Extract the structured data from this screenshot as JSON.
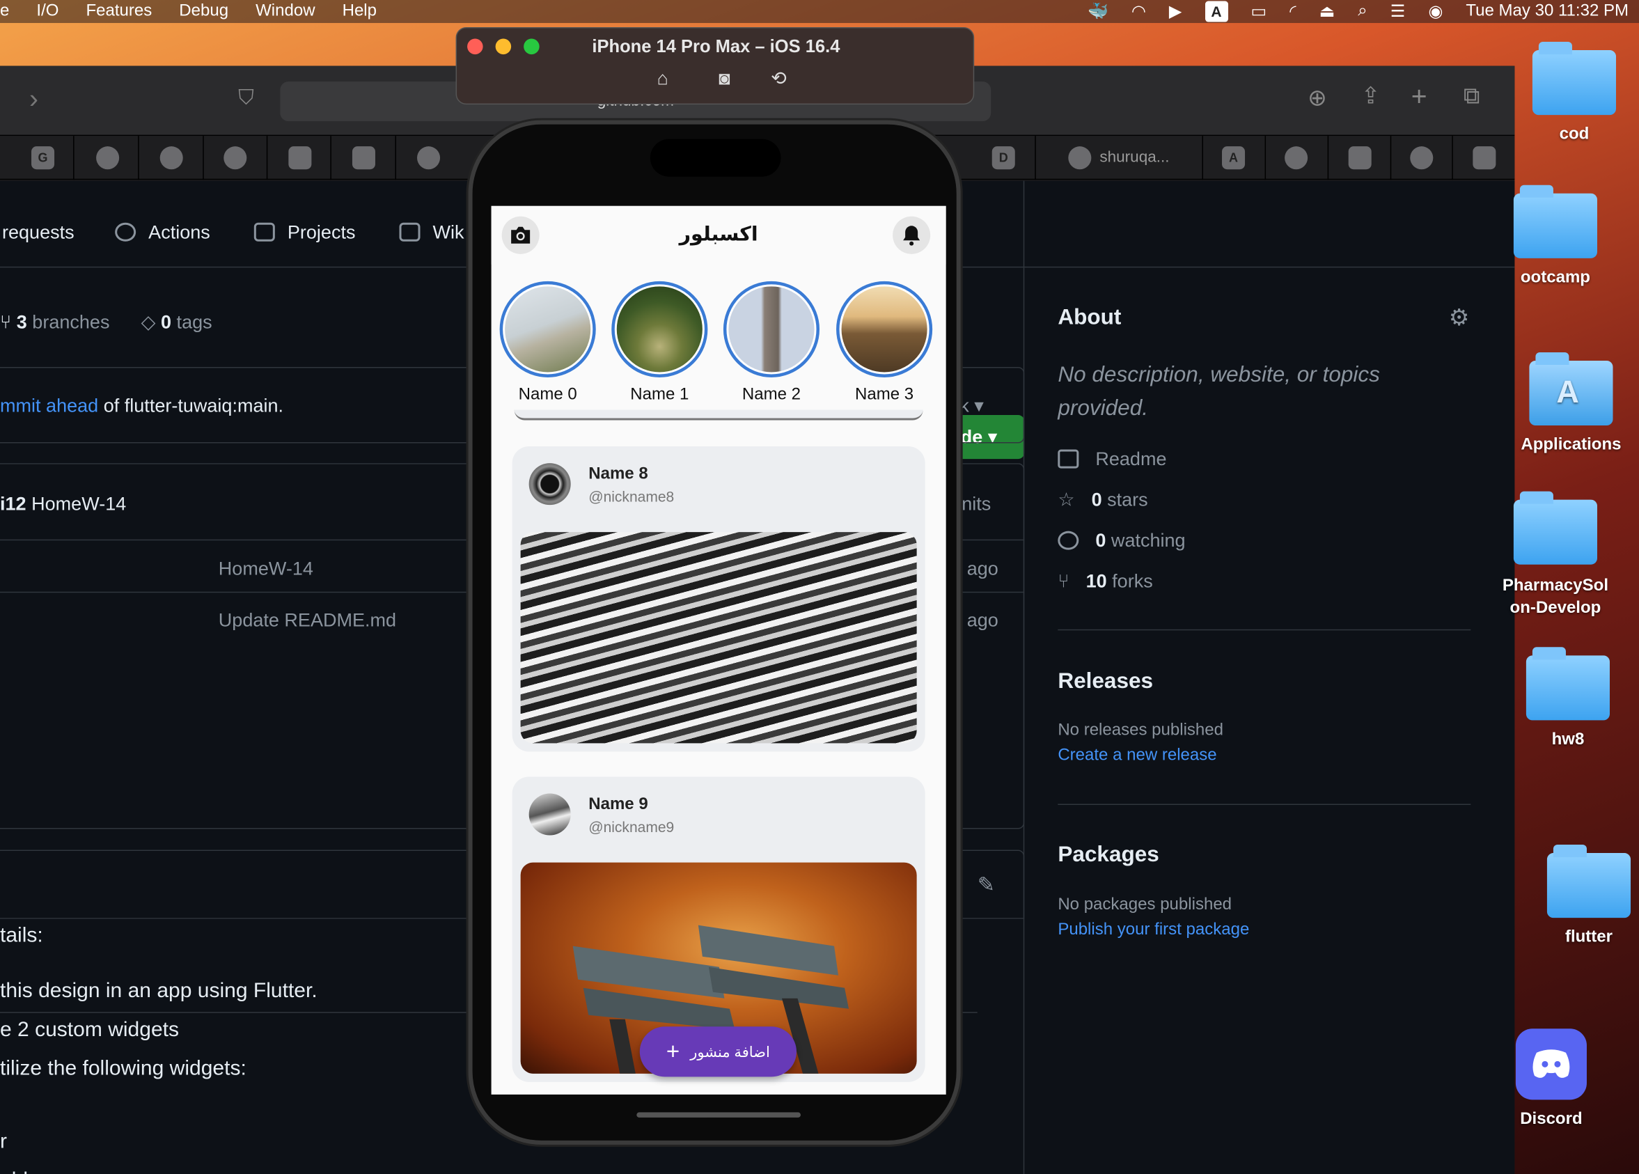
{
  "menubar": {
    "items": [
      "e",
      "I/O",
      "Features",
      "Debug",
      "Window",
      "Help"
    ],
    "datetime": "Tue May 30  11:32 PM",
    "a_badge": "A"
  },
  "browser": {
    "url": "github.com",
    "tab_title": "shuruqa...",
    "tab_letters": [
      "G",
      "D",
      "A"
    ]
  },
  "github": {
    "nav": [
      "requests",
      "Actions",
      "Projects",
      "Wik"
    ],
    "branches": {
      "count": "3",
      "label": "branches"
    },
    "tags": {
      "count": "0",
      "label": "tags"
    },
    "code_button": "de",
    "fork_partial": "k",
    "ahead": {
      "link": "mmit ahead",
      "rest": "of flutter-tuwaiq:main."
    },
    "commit": {
      "author": "i12",
      "message": "HomeW-14",
      "commits": "nits"
    },
    "files": [
      {
        "message": "HomeW-14",
        "age": "ago"
      },
      {
        "message": "Update README.md",
        "age": "ago"
      }
    ],
    "readme_lines": [
      "tails:",
      " this design in an app using Flutter.",
      "e 2 custom widgets",
      "tilize the following widgets:",
      "r",
      "eld"
    ],
    "about": {
      "title": "About",
      "description": "No description, website, or topics provided.",
      "readme": "Readme",
      "stars": {
        "count": "0",
        "label": "stars"
      },
      "watching": {
        "count": "0",
        "label": "watching"
      },
      "forks": {
        "count": "10",
        "label": "forks"
      }
    },
    "releases": {
      "title": "Releases",
      "none": "No releases published",
      "link": "Create a new release"
    },
    "packages": {
      "title": "Packages",
      "none": "No packages published",
      "link": "Publish your first package"
    }
  },
  "desktop": [
    "cod",
    "bootcamp",
    "Applications",
    "PharmacySolution-Develop",
    "hw8",
    "flutter",
    "Discord"
  ],
  "desktop_display": {
    "cod": "cod",
    "bootcamp": "ootcamp",
    "applications": "Applications",
    "pharmacy1": "PharmacySol",
    "pharmacy2": "on-Develop",
    "hw8": "hw8",
    "flutter": "flutter",
    "discord": "Discord"
  },
  "simulator": {
    "title": "iPhone 14 Pro Max – iOS 16.4"
  },
  "app": {
    "title": "اكسبلور",
    "stories": [
      {
        "name": "Name 0"
      },
      {
        "name": "Name 1"
      },
      {
        "name": "Name 2"
      },
      {
        "name": "Name 3"
      }
    ],
    "posts": [
      {
        "name": "Name 8",
        "nickname": "@nickname8"
      },
      {
        "name": "Name 9",
        "nickname": "@nickname9"
      }
    ],
    "fab_label": "اضافة منشور",
    "fab_icon": "plus-icon"
  },
  "colors": {
    "github_green": "#238636",
    "link": "#4493f8",
    "story_ring": "#3a7bd5",
    "fab": "#673ab7"
  }
}
